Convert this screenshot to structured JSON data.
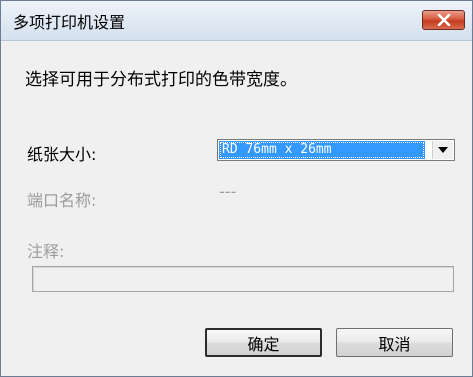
{
  "window": {
    "title": "多项打印机设置",
    "close_icon": "close-icon"
  },
  "description": "选择可用于分布式打印的色带宽度。",
  "paper_size": {
    "label": "纸张大小:",
    "selected": "RD 76mm x 26mm",
    "arrow_icon": "chevron-down-icon"
  },
  "port_name": {
    "label": "端口名称:",
    "value": "---"
  },
  "comment": {
    "label": "注释:",
    "value": ""
  },
  "buttons": {
    "ok": "确定",
    "cancel": "取消"
  },
  "colors": {
    "selection": "#3399ff",
    "close_button": "#c33c20",
    "dialog_background": "#f0f0f0",
    "disabled_text": "#9c9c9c"
  }
}
